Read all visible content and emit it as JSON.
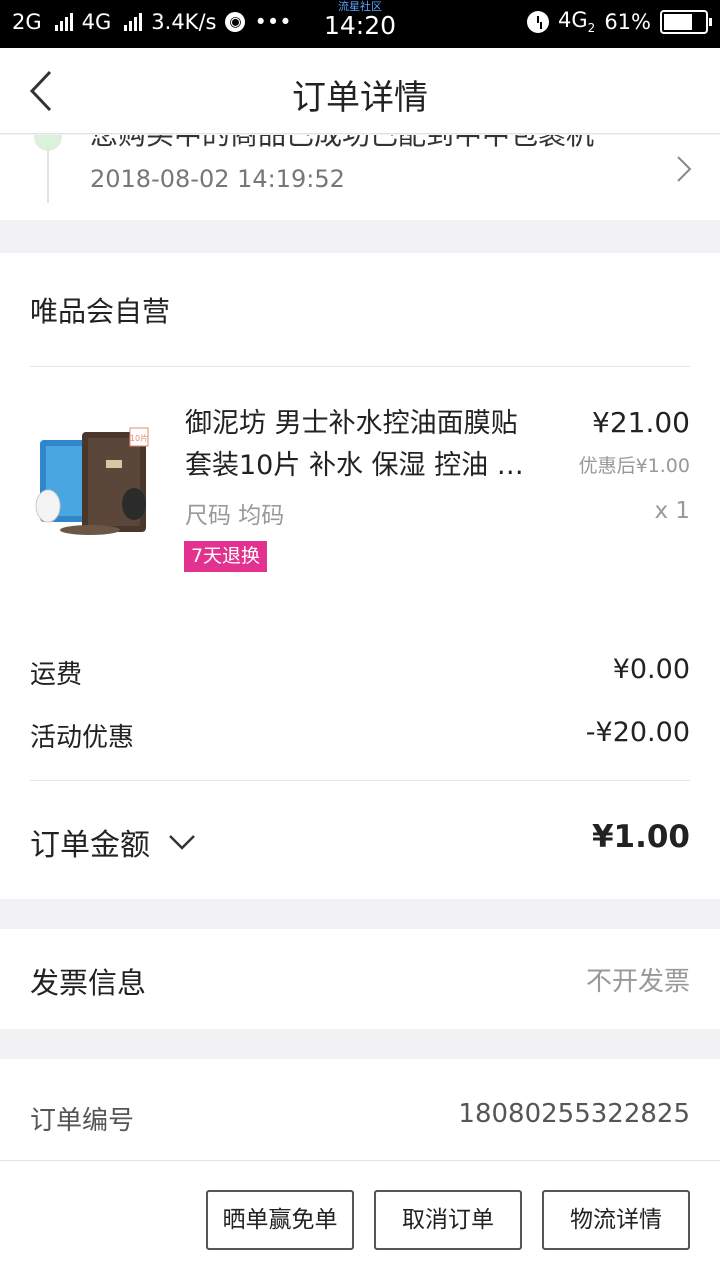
{
  "status_bar": {
    "network_1": "2G",
    "network_2": "4G",
    "speed": "3.4K/s",
    "more": "•••",
    "brand": "流星社区",
    "time": "14:20",
    "network_3": "4G",
    "network_3_sub": "2",
    "battery": "61%"
  },
  "nav": {
    "title": "订单详情"
  },
  "logistics": {
    "status_text_cut": "您购买中的商品已成功已配到中中包裹机",
    "date": "2018-08-02 14:19:52"
  },
  "store": {
    "name": "唯品会自营"
  },
  "product": {
    "name_line1": "御泥坊 男士补水控油面膜贴",
    "name_line2": "套装10片 补水 保湿 控油 提…",
    "price": "¥21.00",
    "after_discount": "优惠后¥1.00",
    "spec": "尺码  均码",
    "qty": "x 1",
    "tag": "7天退换",
    "thumb_badge": "10片"
  },
  "fees": {
    "shipping_label": "运费",
    "shipping_value": "¥0.00",
    "promo_label": "活动优惠",
    "promo_value": "-¥20.00",
    "total_label": "订单金额",
    "total_value": "¥1.00"
  },
  "invoice": {
    "label": "发票信息",
    "value": "不开发票"
  },
  "order": {
    "label": "订单编号",
    "value": "18080255322825"
  },
  "actions": {
    "share": "晒单赢免单",
    "cancel": "取消订单",
    "logistics": "物流详情"
  },
  "colors": {
    "tag_bg": "#e3318f",
    "page_bg": "#f2f2f4"
  }
}
